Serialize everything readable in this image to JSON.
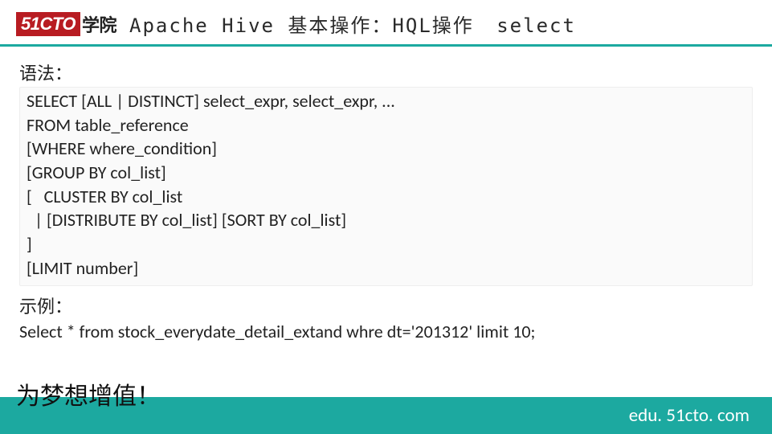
{
  "header": {
    "logo_brand": "51CTO",
    "logo_suffix": "学院",
    "title_main": "Apache Hive 基本操作：HQL操作",
    "title_keyword": "select"
  },
  "syntax": {
    "label": "语法：",
    "lines": [
      "SELECT [ALL | DISTINCT] select_expr, select_expr, ...",
      "FROM table_reference",
      "[WHERE where_condition]",
      "[GROUP BY col_list]",
      "[   CLUSTER BY col_list",
      "  | [DISTRIBUTE BY col_list] [SORT BY col_list]",
      "]",
      "[LIMIT number]"
    ]
  },
  "example": {
    "label": "示例：",
    "line": "Select * from stock_everydate_detail_extand  whre dt='201312' limit 10;"
  },
  "footer": {
    "slogan": "为梦想增值！",
    "url": "edu. 51cto. com"
  },
  "colors": {
    "accent": "#1ca9a0",
    "brand_red": "#b81c22"
  }
}
